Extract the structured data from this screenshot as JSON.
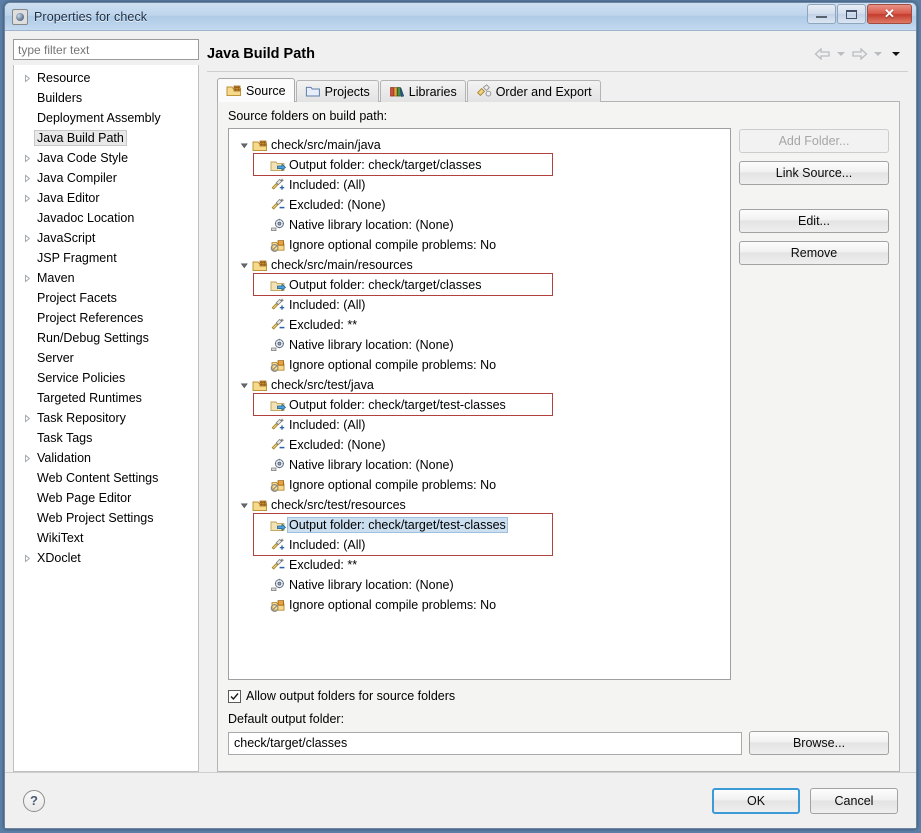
{
  "window": {
    "title": "Properties for check",
    "icon": "eclipse-properties-icon",
    "minimize_label": "Minimize",
    "maximize_label": "Maximize",
    "close_label": "Close"
  },
  "sidebar": {
    "filter_placeholder": "type filter text",
    "filter_value": "",
    "items": [
      {
        "label": "Resource",
        "expandable": true,
        "selected": false
      },
      {
        "label": "Builders",
        "expandable": false,
        "selected": false
      },
      {
        "label": "Deployment Assembly",
        "expandable": false,
        "selected": false
      },
      {
        "label": "Java Build Path",
        "expandable": false,
        "selected": true
      },
      {
        "label": "Java Code Style",
        "expandable": true,
        "selected": false
      },
      {
        "label": "Java Compiler",
        "expandable": true,
        "selected": false
      },
      {
        "label": "Java Editor",
        "expandable": true,
        "selected": false
      },
      {
        "label": "Javadoc Location",
        "expandable": false,
        "selected": false
      },
      {
        "label": "JavaScript",
        "expandable": true,
        "selected": false
      },
      {
        "label": "JSP Fragment",
        "expandable": false,
        "selected": false
      },
      {
        "label": "Maven",
        "expandable": true,
        "selected": false
      },
      {
        "label": "Project Facets",
        "expandable": false,
        "selected": false
      },
      {
        "label": "Project References",
        "expandable": false,
        "selected": false
      },
      {
        "label": "Run/Debug Settings",
        "expandable": false,
        "selected": false
      },
      {
        "label": "Server",
        "expandable": false,
        "selected": false
      },
      {
        "label": "Service Policies",
        "expandable": false,
        "selected": false
      },
      {
        "label": "Targeted Runtimes",
        "expandable": false,
        "selected": false
      },
      {
        "label": "Task Repository",
        "expandable": true,
        "selected": false
      },
      {
        "label": "Task Tags",
        "expandable": false,
        "selected": false
      },
      {
        "label": "Validation",
        "expandable": true,
        "selected": false
      },
      {
        "label": "Web Content Settings",
        "expandable": false,
        "selected": false
      },
      {
        "label": "Web Page Editor",
        "expandable": false,
        "selected": false
      },
      {
        "label": "Web Project Settings",
        "expandable": false,
        "selected": false
      },
      {
        "label": "WikiText",
        "expandable": false,
        "selected": false
      },
      {
        "label": "XDoclet",
        "expandable": true,
        "selected": false
      }
    ]
  },
  "page": {
    "title": "Java Build Path",
    "nav_back": "back-arrow",
    "nav_forward": "forward-arrow",
    "nav_menu": "view-menu"
  },
  "tabs": [
    {
      "label": "Source",
      "icon": "source-folder-icon",
      "active": true
    },
    {
      "label": "Projects",
      "icon": "projects-icon",
      "active": false
    },
    {
      "label": "Libraries",
      "icon": "libraries-icon",
      "active": false
    },
    {
      "label": "Order and Export",
      "icon": "order-export-icon",
      "active": false
    }
  ],
  "source_tab": {
    "section_label": "Source folders on build path:",
    "groups": [
      {
        "name": "check/src/main/java",
        "icon": "source-folder-icon",
        "children": [
          {
            "label": "Output folder: check/target/classes",
            "icon": "output-folder-icon",
            "highlighted": true,
            "selected": false
          },
          {
            "label": "Included: (All)",
            "icon": "included-icon",
            "highlighted": false,
            "selected": false
          },
          {
            "label": "Excluded: (None)",
            "icon": "excluded-icon",
            "highlighted": false,
            "selected": false
          },
          {
            "label": "Native library location: (None)",
            "icon": "native-library-icon",
            "highlighted": false,
            "selected": false
          },
          {
            "label": "Ignore optional compile problems: No",
            "icon": "ignore-problems-icon",
            "highlighted": false,
            "selected": false
          }
        ]
      },
      {
        "name": "check/src/main/resources",
        "icon": "source-folder-icon",
        "children": [
          {
            "label": "Output folder: check/target/classes",
            "icon": "output-folder-icon",
            "highlighted": true,
            "selected": false
          },
          {
            "label": "Included: (All)",
            "icon": "included-icon",
            "highlighted": false,
            "selected": false
          },
          {
            "label": "Excluded: **",
            "icon": "excluded-icon",
            "highlighted": false,
            "selected": false
          },
          {
            "label": "Native library location: (None)",
            "icon": "native-library-icon",
            "highlighted": false,
            "selected": false
          },
          {
            "label": "Ignore optional compile problems: No",
            "icon": "ignore-problems-icon",
            "highlighted": false,
            "selected": false
          }
        ]
      },
      {
        "name": "check/src/test/java",
        "icon": "source-folder-icon",
        "children": [
          {
            "label": "Output folder: check/target/test-classes",
            "icon": "output-folder-icon",
            "highlighted": true,
            "selected": false
          },
          {
            "label": "Included: (All)",
            "icon": "included-icon",
            "highlighted": false,
            "selected": false
          },
          {
            "label": "Excluded: (None)",
            "icon": "excluded-icon",
            "highlighted": false,
            "selected": false
          },
          {
            "label": "Native library location: (None)",
            "icon": "native-library-icon",
            "highlighted": false,
            "selected": false
          },
          {
            "label": "Ignore optional compile problems: No",
            "icon": "ignore-problems-icon",
            "highlighted": false,
            "selected": false
          }
        ]
      },
      {
        "name": "check/src/test/resources",
        "icon": "source-folder-icon",
        "children": [
          {
            "label": "Output folder: check/target/test-classes",
            "icon": "output-folder-icon",
            "highlighted": true,
            "selected": true
          },
          {
            "label": "Included: (All)",
            "icon": "included-icon",
            "highlighted": true,
            "selected": false
          },
          {
            "label": "Excluded: **",
            "icon": "excluded-icon",
            "highlighted": false,
            "selected": false
          },
          {
            "label": "Native library location: (None)",
            "icon": "native-library-icon",
            "highlighted": false,
            "selected": false
          },
          {
            "label": "Ignore optional compile problems: No",
            "icon": "ignore-problems-icon",
            "highlighted": false,
            "selected": false
          }
        ]
      }
    ],
    "buttons": [
      {
        "label": "Add Folder...",
        "enabled": false
      },
      {
        "label": "Link Source...",
        "enabled": true
      },
      {
        "label": "Edit...",
        "enabled": true
      },
      {
        "label": "Remove",
        "enabled": true
      }
    ],
    "allow_output_label": "Allow output folders for source folders",
    "allow_output_checked": true,
    "default_output_label": "Default output folder:",
    "default_output_value": "check/target/classes",
    "browse_label": "Browse..."
  },
  "footer": {
    "help_label": "?",
    "ok_label": "OK",
    "cancel_label": "Cancel"
  },
  "colors": {
    "highlight_red": "#b0413c",
    "selection_blue": "#cbdff1",
    "focus_blue": "#3c9ad6"
  }
}
